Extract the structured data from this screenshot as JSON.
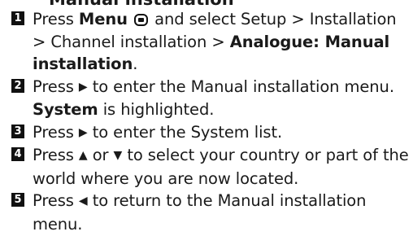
{
  "heading_fragment": "Manual installation",
  "steps": [
    {
      "number": "1",
      "t1": "Press ",
      "b1": "Menu",
      "menu_icon": "menu-button-icon",
      "t2": " and select Setup > Installation > Channel installation > ",
      "b2": "Analogue: Manual installation",
      "t3": "."
    },
    {
      "number": "2",
      "t1": "Press ",
      "key": "▶",
      "t2": " to enter the Manual installation menu. ",
      "b1": "System",
      "t3": " is highlighted."
    },
    {
      "number": "3",
      "t1": "Press ",
      "key": "▶",
      "t2": " to enter the System list."
    },
    {
      "number": "4",
      "t1": "Press ",
      "key1": "▲",
      "t2": " or ",
      "key2": "▼",
      "t3": " to select your country or part of the world where you are now located."
    },
    {
      "number": "5",
      "t1": "Press ",
      "key": "◀",
      "t2": " to return to the Manual installation menu."
    }
  ]
}
